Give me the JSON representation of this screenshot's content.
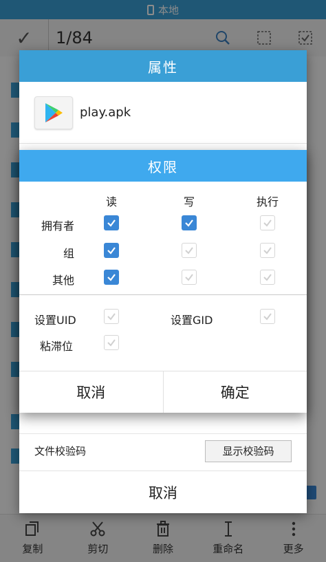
{
  "status_bar": {
    "title": "本地"
  },
  "toolbar": {
    "selection_count": "1/84"
  },
  "bottom_bar": {
    "items": [
      {
        "label": "复制",
        "icon": "copy-icon"
      },
      {
        "label": "剪切",
        "icon": "scissors-icon"
      },
      {
        "label": "删除",
        "icon": "trash-icon"
      },
      {
        "label": "重命名",
        "icon": "rename-icon"
      },
      {
        "label": "更多",
        "icon": "more-vertical-icon"
      }
    ]
  },
  "properties_dialog": {
    "title": "属性",
    "file_name": "play.apk",
    "checksum_label": "文件校验码",
    "checksum_button": "显示校验码",
    "cancel_label": "取消"
  },
  "permissions_dialog": {
    "title": "权限",
    "columns": [
      "读",
      "写",
      "执行"
    ],
    "rows": [
      {
        "label": "拥有者",
        "read": true,
        "write": true,
        "execute": false
      },
      {
        "label": "组",
        "read": true,
        "write": false,
        "execute": false
      },
      {
        "label": "其他",
        "read": true,
        "write": false,
        "execute": false
      }
    ],
    "special": {
      "setuid_label": "设置UID",
      "setuid": false,
      "setgid_label": "设置GID",
      "setgid": false,
      "sticky_label": "粘滞位",
      "sticky": false
    },
    "cancel_label": "取消",
    "ok_label": "确定"
  },
  "colors": {
    "accent": "#3a9fd6",
    "dialog_title": "#3fa9ee",
    "checkbox_on": "#3a87d6"
  }
}
